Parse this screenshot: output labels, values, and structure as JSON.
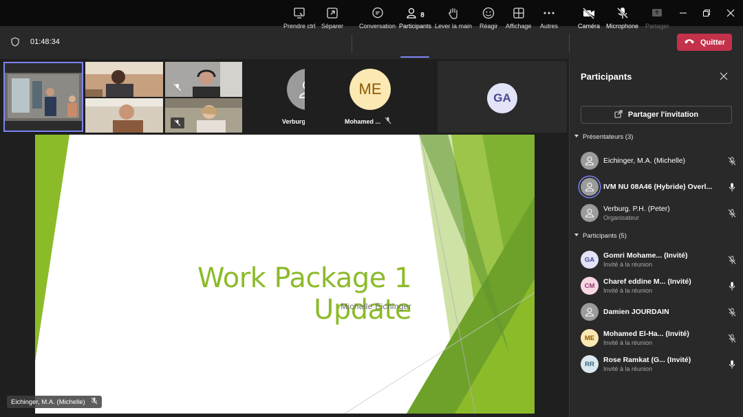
{
  "window": {
    "controls": [
      "minimize-icon",
      "maximize-icon",
      "close-icon"
    ]
  },
  "toolbar": {
    "timer": "01:48:34",
    "items": [
      {
        "key": "share",
        "label": "Prendre ctrl",
        "icon": "share-screen-icon"
      },
      {
        "key": "pop",
        "label": "Séparer",
        "icon": "pop-out-icon"
      },
      {
        "key": "chat",
        "label": "Conversation",
        "icon": "chat-icon"
      },
      {
        "key": "participants",
        "label": "Participants",
        "count": "8",
        "icon": "people-icon"
      },
      {
        "key": "hand",
        "label": "Lever la main",
        "icon": "raise-hand-icon"
      },
      {
        "key": "react",
        "label": "Réagir",
        "icon": "smiley-icon"
      },
      {
        "key": "view",
        "label": "Affichage",
        "icon": "grid-view-icon"
      },
      {
        "key": "more",
        "label": "Autres",
        "icon": "more-icon"
      },
      {
        "key": "camera",
        "label": "Caméra",
        "icon": "camera-off-icon"
      },
      {
        "key": "mic",
        "label": "Microphone",
        "icon": "mic-off-icon"
      },
      {
        "key": "present",
        "label": "Partager",
        "icon": "share-tray-icon"
      }
    ],
    "quit_label": "Quitter"
  },
  "stage": {
    "tiles": [
      {
        "initials": "",
        "name": "Verburg, P....",
        "avatar_color": "#9b9b9b"
      },
      {
        "initials": "ME",
        "name": "Mohamed ...",
        "avatar_color": "#fbe8b3",
        "text_color": "#8a5a00"
      },
      {
        "initials": "GA",
        "name": "",
        "avatar_color": "#e3e3f7",
        "text_color": "#444791"
      }
    ],
    "slide": {
      "title": "Work Package 1 Update",
      "subtitle": "Michelle Eichinger"
    },
    "presenter_tag": "Eichinger, M.A. (Michelle)"
  },
  "panel": {
    "title": "Participants",
    "invite_label": "Partager l'invitation",
    "presenters_header": "Présentateurs (3)",
    "presenters": [
      {
        "name": "Eichinger, M.A. (Michelle)",
        "sub": "",
        "initials": "",
        "avatar_color": "#9b9b9b",
        "mic": "muted",
        "bold": false
      },
      {
        "name": "IVM NU 08A46 (Hybride) Overl...",
        "sub": "",
        "initials": "",
        "avatar_color": "#9b9b9b",
        "mic": "on",
        "bold": true
      },
      {
        "name": "Verburg. P.H. (Peter)",
        "sub": "Organisateur",
        "initials": "",
        "avatar_color": "#9b9b9b",
        "mic": "muted",
        "bold": false
      }
    ],
    "participants_header": "Participants (5)",
    "participants": [
      {
        "name": "Gomri Mohame...   (Invité)",
        "sub": "Invité à la réunion",
        "initials": "GA",
        "avatar_color": "#e3e3f7",
        "text_color": "#444791",
        "mic": "muted"
      },
      {
        "name": "Charef eddine M... (Invité)",
        "sub": "Invité à la réunion",
        "initials": "CM",
        "avatar_color": "#f6d7e3",
        "text_color": "#943670",
        "mic": "on"
      },
      {
        "name": "Damien JOURDAIN",
        "sub": "",
        "initials": "",
        "avatar_color": "#9b9b9b",
        "text_color": "#fff",
        "mic": "muted"
      },
      {
        "name": "Mohamed El-Ha...   (Invité)",
        "sub": "Invité à la réunion",
        "initials": "ME",
        "avatar_color": "#fbe8b3",
        "text_color": "#8a5a00",
        "mic": "muted"
      },
      {
        "name": "Rose Ramkat (G...   (Invité)",
        "sub": "Invité à la réunion",
        "initials": "RR",
        "avatar_color": "#dbe8f0",
        "text_color": "#3b6577",
        "mic": "on"
      }
    ]
  },
  "colors": {
    "accent": "#7f85f5",
    "quit": "#c4314b",
    "slide_green": "#8cbb2a"
  }
}
